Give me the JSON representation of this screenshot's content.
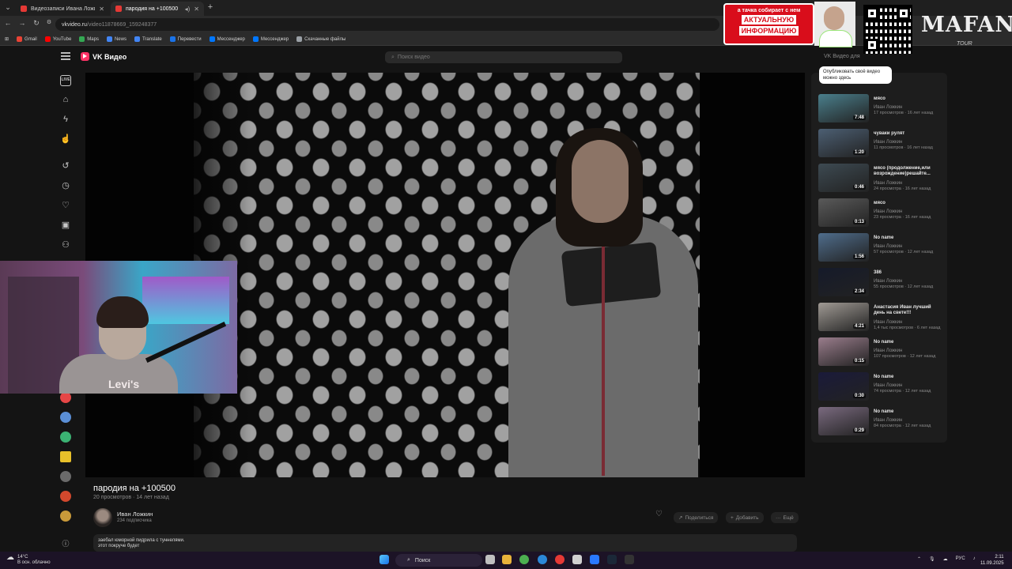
{
  "browser": {
    "tabs": [
      {
        "title": "Видеозаписи Ивана Ложкина",
        "active": false
      },
      {
        "title": "пародия на +100500",
        "active": true
      }
    ],
    "url_host": "vkvideo.ru",
    "url_path": "/video11878669_159248377",
    "bookmarks": [
      {
        "label": "Gmail",
        "color": "#ea4335"
      },
      {
        "label": "YouTube",
        "color": "#ff0000"
      },
      {
        "label": "Maps",
        "color": "#34a853"
      },
      {
        "label": "News",
        "color": "#4285f4"
      },
      {
        "label": "Translate",
        "color": "#4285f4"
      },
      {
        "label": "Перевести",
        "color": "#1a73e8"
      },
      {
        "label": "Мессенджер",
        "color": "#0077ff"
      },
      {
        "label": "Мессенджер",
        "color": "#0077ff"
      },
      {
        "label": "Скачанные файлы",
        "color": "#9aa0a6"
      }
    ]
  },
  "vk": {
    "logo_text": "VK Видео",
    "search_placeholder": "Поиск видео",
    "creators_link": "VK Видео для",
    "tooltip": "Опубликовать своё видео можно здесь",
    "sidebar_icons": [
      "live-icon",
      "home-icon",
      "shorts-icon",
      "favorites-icon",
      "history-icon",
      "watch-later-icon",
      "liked-icon",
      "library-icon",
      "subscriptions-icon"
    ],
    "channel_icons": [
      "#e64646",
      "#5b8fd6",
      "#3bb273",
      "#e8c02a",
      "#6a6a6a",
      "#d2482d",
      "#c99a3a"
    ],
    "accent": "#0077ff"
  },
  "video": {
    "title": "пародия на +100500",
    "stats": "20 просмотров · 14 лет назад",
    "channel_name": "Иван Ложкин",
    "channel_subs": "234 подписчика",
    "actions": [
      "Поделиться",
      "Добавить",
      "Ещё"
    ],
    "description_line1": "заебал юморной пидрила с туннелями.",
    "description_line2": "этот покруче будет"
  },
  "recommendations": [
    {
      "title": "мясо",
      "author": "Иван Ложкин",
      "meta": "17 просмотров · 16 лет назад",
      "duration": "7:48",
      "thumb": "#4a7f8c"
    },
    {
      "title": "чуваки рулят",
      "author": "Иван Ложкин",
      "meta": "11 просмотров · 16 лет назад",
      "duration": "1:20",
      "thumb": "#4c5f73"
    },
    {
      "title": "мясо (продолжение,или возрождение)решайте...",
      "author": "Иван Ложкин",
      "meta": "24 просмотра · 16 лет назад",
      "duration": "0:46",
      "thumb": "#3d4a52"
    },
    {
      "title": "мясо",
      "author": "Иван Ложкин",
      "meta": "23 просмотра · 16 лет назад",
      "duration": "0:13",
      "thumb": "#5a5a5a"
    },
    {
      "title": "No name",
      "author": "Иван Ложкин",
      "meta": "57 просмотров · 12 лет назад",
      "duration": "1:56",
      "thumb": "#4f6d8c"
    },
    {
      "title": "386",
      "author": "Иван Ложкин",
      "meta": "55 просмотров · 12 лет назад",
      "duration": "2:34",
      "thumb": "#151a2a"
    },
    {
      "title": "Анастасия Иван лучший день на свете!!!",
      "author": "Иван Ложкин",
      "meta": "1,4 тыс просмотров · 6 лет назад",
      "duration": "4:21",
      "thumb": "#a09a94"
    },
    {
      "title": "No name",
      "author": "Иван Ложкин",
      "meta": "107 просмотров · 12 лет назад",
      "duration": "0:15",
      "thumb": "#9a7d8c"
    },
    {
      "title": "No name",
      "author": "Иван Ложкин",
      "meta": "74 просмотра · 12 лет назад",
      "duration": "0:30",
      "thumb": "#1a1a3a"
    },
    {
      "title": "No name",
      "author": "Иван Ложкин",
      "meta": "84 просмотра · 12 лет назад",
      "duration": "0:29",
      "thumb": "#7a6a7f"
    }
  ],
  "overlay": {
    "promo_line1": "а тачка собирает с нем",
    "promo_big1": "АКТУАЛЬНУЮ",
    "promo_big2": "ИНФОРМАЦИЮ",
    "brand": "MAFANYA",
    "brand_sub": "TOUR",
    "cam_shirt": "Levi's",
    "promo_color": "#d90d1b"
  },
  "taskbar": {
    "weather_temp": "14°C",
    "weather_desc": "В осн. облачно",
    "search_label": "Поиск",
    "lang": "РУС",
    "time": "2:11",
    "date": "11.09.2025"
  }
}
